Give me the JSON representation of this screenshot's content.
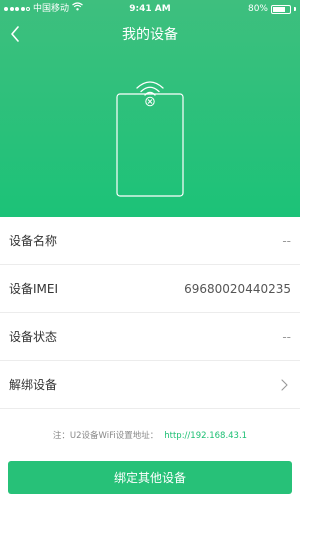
{
  "status_bar": {
    "carrier": "中国移动",
    "time": "9:41 AM",
    "battery_percent": "80%",
    "battery_level": 0.8
  },
  "header": {
    "title": "我的设备",
    "back_icon": "chevron-left-icon"
  },
  "colors": {
    "header_green": "#1cc278",
    "button_green": "#27c178",
    "link_green": "#1cbf73"
  },
  "device_rows": [
    {
      "label": "设备名称",
      "value": "--"
    },
    {
      "label": "设备IMEI",
      "value": "69680020440235"
    },
    {
      "label": "设备状态",
      "value": "--"
    },
    {
      "label": "解绑设备",
      "icon": "chevron-right-icon"
    }
  ],
  "note": {
    "text": "注：U2设备WiFi设置地址：",
    "url": "http://192.168.43.1"
  },
  "actions": {
    "bind_other_label": "绑定其他设备"
  }
}
